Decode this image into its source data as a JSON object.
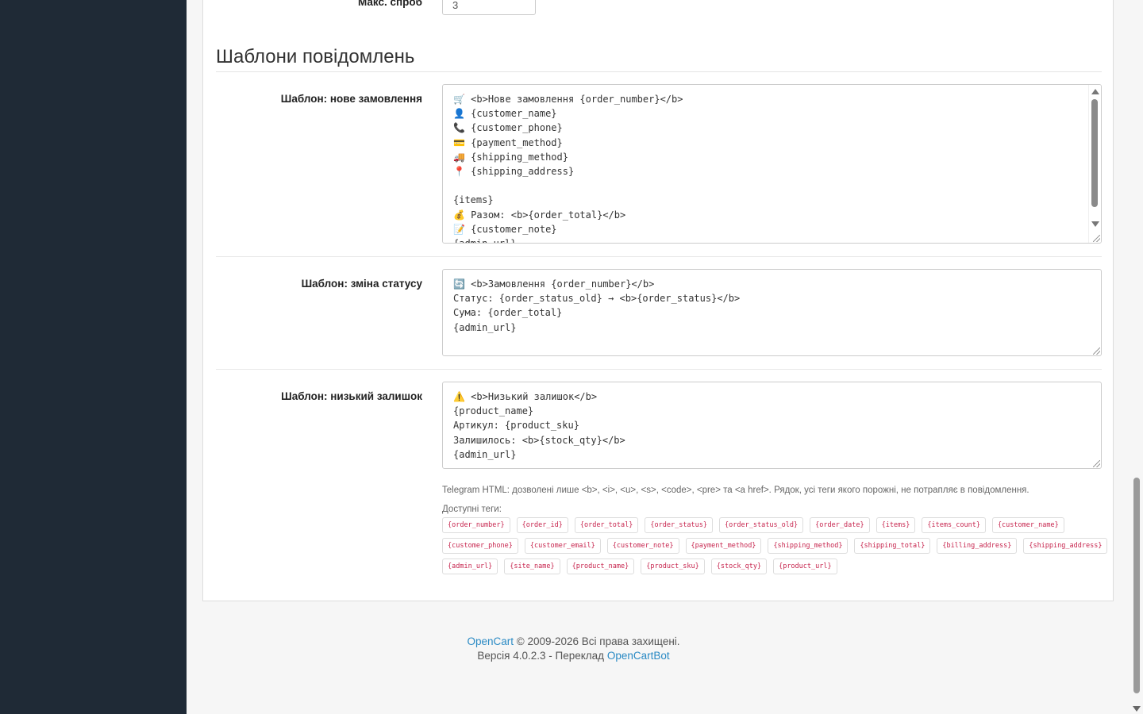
{
  "max_attempts": {
    "label": "Макс. спроб",
    "value": "3"
  },
  "section_title": "Шаблони повідомлень",
  "templates": {
    "new_order": {
      "label": "Шаблон: нове замовлення",
      "content": "🛒 <b>Нове замовлення {order_number}</b>\n👤 {customer_name}\n📞 {customer_phone}\n💳 {payment_method}\n🚚 {shipping_method}\n📍 {shipping_address}\n\n{items}\n💰 Разом: <b>{order_total}</b>\n📝 {customer_note}\n{admin_url}"
    },
    "status_change": {
      "label": "Шаблон: зміна статусу",
      "content": "🔄 <b>Замовлення {order_number}</b>\nСтатус: {order_status_old} → <b>{order_status}</b>\nСума: {order_total}\n{admin_url}"
    },
    "low_stock": {
      "label": "Шаблон: низький залишок",
      "content": "⚠️ <b>Низький залишок</b>\n{product_name}\nАртикул: {product_sku}\nЗалишилось: <b>{stock_qty}</b>\n{admin_url}"
    }
  },
  "help_text": "Telegram HTML: дозволені лише <b>, <i>, <u>, <s>, <code>, <pre> та <a href>. Рядок, усі теги якого порожні, не потрапляє в повідомлення.",
  "tags_label": "Доступні теги:",
  "tags": [
    [
      "{order_number}",
      "{order_id}",
      "{order_total}",
      "{order_status}",
      "{order_status_old}",
      "{order_date}",
      "{items}",
      "{items_count}",
      "{customer_name}"
    ],
    [
      "{customer_phone}",
      "{customer_email}",
      "{customer_note}",
      "{payment_method}",
      "{shipping_method}",
      "{shipping_total}",
      "{billing_address}",
      "{shipping_address}"
    ],
    [
      "{admin_url}",
      "{site_name}",
      "{product_name}",
      "{product_sku}",
      "{stock_qty}",
      "{product_url}"
    ]
  ],
  "footer": {
    "brand": "OpenCart",
    "copyright": " © 2009-2026 Всі права захищені.",
    "version_text": "Версія 4.0.2.3 - Переклад ",
    "translator": "OpenCartBot"
  }
}
